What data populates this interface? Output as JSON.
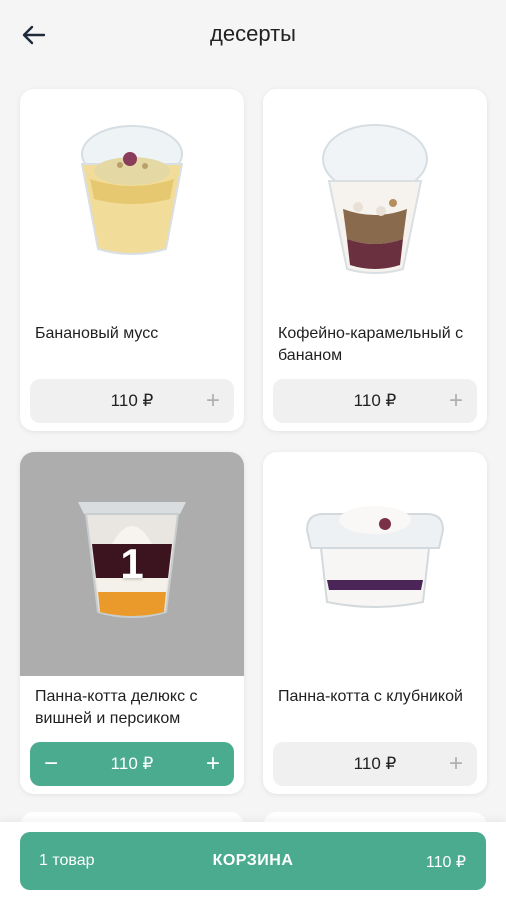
{
  "header": {
    "title": "десерты",
    "back_icon": "arrow-left-icon"
  },
  "products": [
    {
      "name": "Банановый мусс",
      "price": "110 ₽",
      "plus": "+",
      "quantity": 0
    },
    {
      "name": "Кофейно-карамельный с бананом",
      "price": "110 ₽",
      "plus": "+",
      "quantity": 0
    },
    {
      "name": "Панна-котта делюкс с вишней и персиком",
      "price": "110 ₽",
      "plus": "+",
      "minus": "−",
      "quantity": "1"
    },
    {
      "name": "Панна-котта с клубникой",
      "price": "110 ₽",
      "plus": "+",
      "quantity": 0
    }
  ],
  "cart": {
    "count": "1 товар",
    "label": "КОРЗИНА",
    "total": "110 ₽"
  },
  "colors": {
    "accent": "#4aab8e",
    "selected_overlay": "#adadad"
  }
}
